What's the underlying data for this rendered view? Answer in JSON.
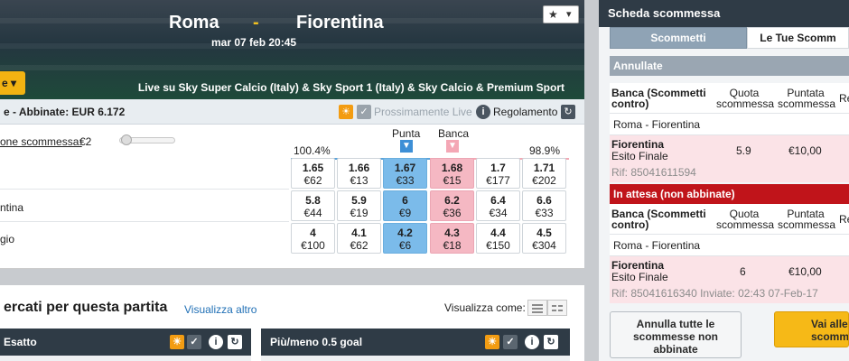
{
  "event": {
    "home": "Roma",
    "separator": "-",
    "away": "Fiorentina",
    "kickoff": "mar 07 feb 20:45",
    "live_tv": "Live su Sky Super Calcio (Italy) & Sky Sport 1 (Italy) & Sky Calcio & Premium Sport",
    "star_icon": "★",
    "dropdown_caret": "▾",
    "left_button": "e ▾"
  },
  "market": {
    "title": "e - Abbinate: EUR 6.172",
    "coming_soon": "Prossimamente Live",
    "rules": "Regolamento",
    "stake_label": "one scommessa:",
    "stake_value": "€2",
    "back_pct": "100.4%",
    "lay_pct": "98.9%",
    "back_label": "Punta",
    "lay_label": "Banca",
    "runners": [
      {
        "name": "",
        "odds": [
          {
            "o": "1.65",
            "m": "€62"
          },
          {
            "o": "1.66",
            "m": "€13"
          },
          {
            "o": "1.67",
            "m": "€33"
          },
          {
            "o": "1.68",
            "m": "€15"
          },
          {
            "o": "1.7",
            "m": "€177"
          },
          {
            "o": "1.71",
            "m": "€202"
          }
        ]
      },
      {
        "name": "ntina",
        "odds": [
          {
            "o": "5.8",
            "m": "€44"
          },
          {
            "o": "5.9",
            "m": "€19"
          },
          {
            "o": "6",
            "m": "€9"
          },
          {
            "o": "6.2",
            "m": "€36"
          },
          {
            "o": "6.4",
            "m": "€34"
          },
          {
            "o": "6.6",
            "m": "€33"
          }
        ]
      },
      {
        "name": "gio",
        "odds": [
          {
            "o": "4",
            "m": "€100"
          },
          {
            "o": "4.1",
            "m": "€62"
          },
          {
            "o": "4.2",
            "m": "€6"
          },
          {
            "o": "4.3",
            "m": "€18"
          },
          {
            "o": "4.4",
            "m": "€150"
          },
          {
            "o": "4.5",
            "m": "€304"
          }
        ]
      }
    ]
  },
  "other_markets": {
    "title": "ercati per questa partita",
    "more_link": "Visualizza altro",
    "view_as": "Visualizza come:",
    "sub1": "Esatto",
    "sub2": "Più/meno 0.5 goal"
  },
  "slip": {
    "title": "Scheda scommessa",
    "tab_bets": "Scommetti",
    "tab_my": "Le Tue Scomm",
    "cancelled": "Annullate",
    "col_lay": "Banca (Scommetti contro)",
    "col_odds": "Quota scommessa",
    "col_stake": "Puntata scommessa",
    "col_re": "Re",
    "match": "Roma - Fiorentina",
    "bet1": {
      "sel": "Fiorentina",
      "mkt": "Esito Finale",
      "odds": "5.9",
      "stake": "€10,00",
      "ref": "Rif: 85041611594"
    },
    "pending": "In attesa (non abbinate)",
    "bet2": {
      "sel": "Fiorentina",
      "mkt": "Esito Finale",
      "odds": "6",
      "stake": "€10,00",
      "ref": "Rif: 85041616340  Inviate: 02:43 07-Feb-17"
    },
    "cancel_all": "Annulla tutte le scommesse non abbinate",
    "go_to": "Vai alle scomme"
  }
}
